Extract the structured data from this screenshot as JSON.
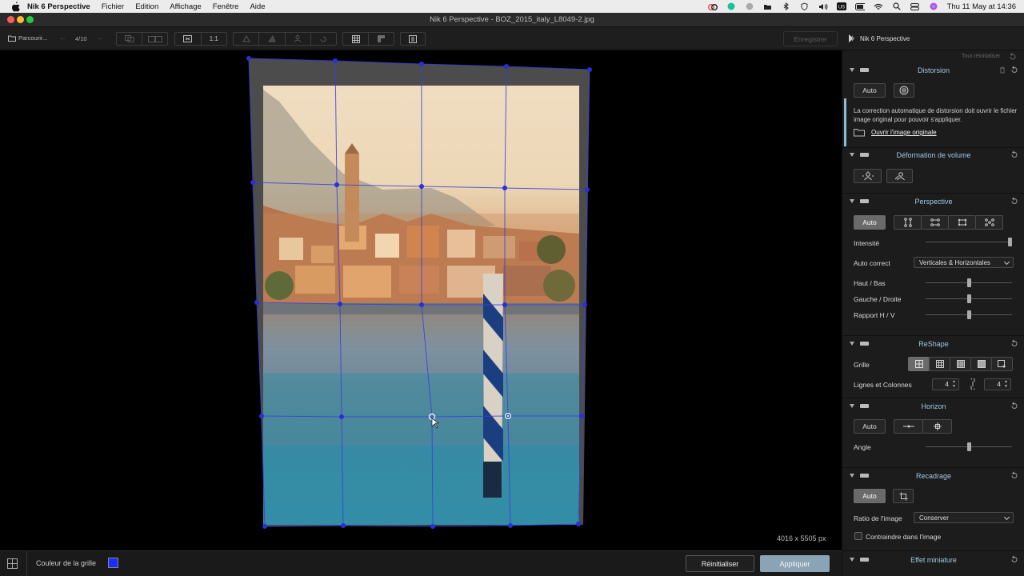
{
  "menubar": {
    "app": "Nik 6 Perspective",
    "items": [
      "Fichier",
      "Edition",
      "Affichage",
      "Fenêtre",
      "Aide"
    ],
    "clock": "Thu 11 May at 14:36",
    "status_icons": [
      "creative-cloud-icon",
      "grammarly-icon",
      "globe-icon",
      "folder-icon",
      "bluetooth-icon",
      "shield-icon",
      "volume-icon",
      "keyboard-input-icon",
      "battery-icon",
      "wifi-icon",
      "search-icon",
      "control-center-icon",
      "siri-icon"
    ]
  },
  "window": {
    "title": "Nik 6 Perspective - BOZ_2015_italy_L8049-2.jpg"
  },
  "toolbar": {
    "browse_label": "Parcourir...",
    "counter": "4/10",
    "zoom_label": "1:1",
    "save_label": "Enregistrer",
    "brand": "Nik 6 Perspective"
  },
  "canvas": {
    "dimensions": "4016 x 5505 px"
  },
  "footer": {
    "grid_color_label": "Couleur de la grille",
    "grid_color": "#1a2dff",
    "reset_label": "Réinitialiser",
    "apply_label": "Appliquer"
  },
  "panel": {
    "reset_all": "Tout réinitialiser",
    "distortion": {
      "title": "Distorsion",
      "auto": "Auto",
      "note": "La correction automatique de distorsion doit ouvrir le fichier image original pour pouvoir s'appliquer.",
      "link": "Ouvrir l'image originale"
    },
    "volume": {
      "title": "Déformation de volume"
    },
    "perspective": {
      "title": "Perspective",
      "auto": "Auto",
      "intensity_label": "Intensité",
      "intensity": 1.0,
      "auto_correct_label": "Auto correct",
      "auto_correct_value": "Verticales & Horizontales",
      "top_bottom_label": "Haut / Bas",
      "top_bottom": 0.5,
      "left_right_label": "Gauche / Droite",
      "left_right": 0.5,
      "ratio_label": "Rapport H / V",
      "ratio": 0.5
    },
    "reshape": {
      "title": "ReShape",
      "grid_label": "Grille",
      "rows_cols_label": "Lignes et Colonnes",
      "rows": "4",
      "cols": "4"
    },
    "horizon": {
      "title": "Horizon",
      "auto": "Auto",
      "angle_label": "Angle",
      "angle": 0.5
    },
    "crop": {
      "title": "Recadrage",
      "auto": "Auto",
      "ratio_label": "Ratio de l'image",
      "ratio_value": "Conserver",
      "constrain_label": "Contraindre dans l'image"
    },
    "miniature": {
      "title": "Effet miniature"
    }
  }
}
